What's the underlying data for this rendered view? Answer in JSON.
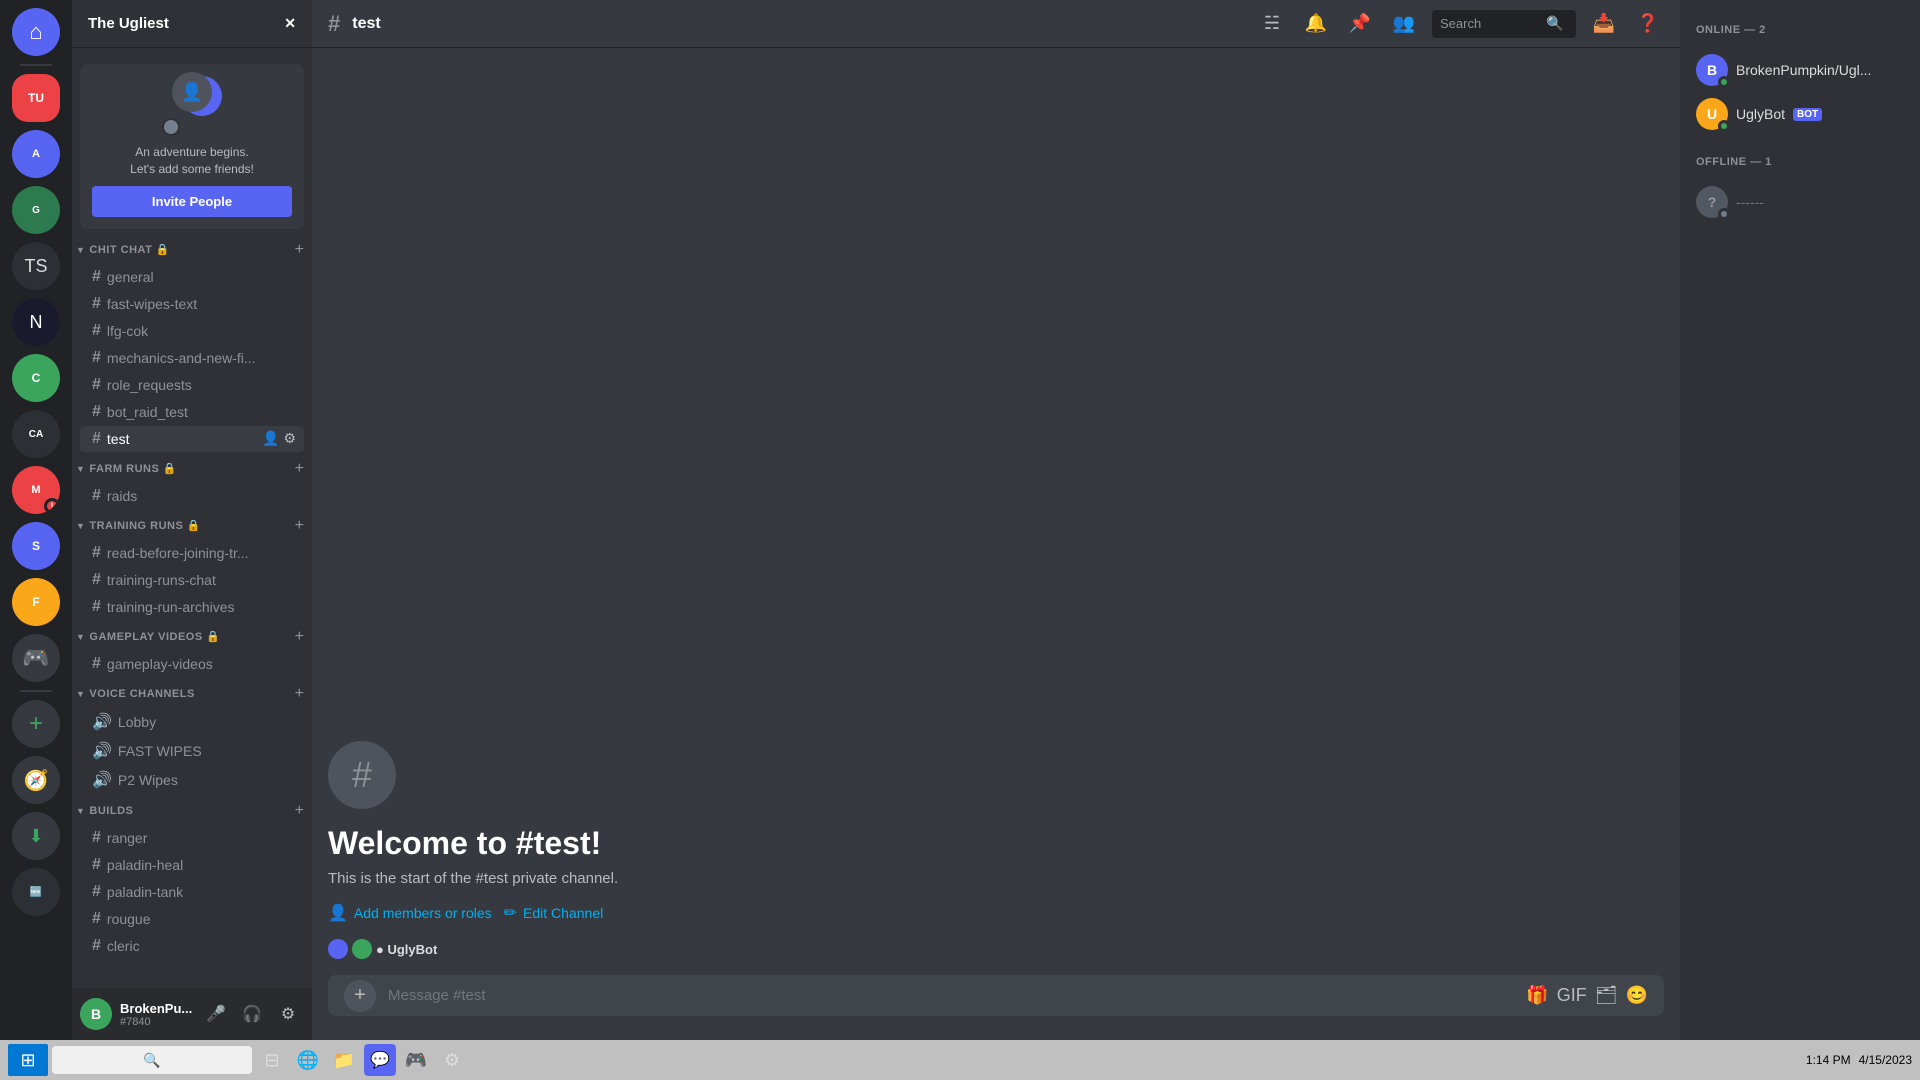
{
  "server": {
    "name": "The Ugliest",
    "channel_active": "test"
  },
  "header": {
    "channel_name": "test",
    "search_placeholder": "Search"
  },
  "invite_banner": {
    "line1": "An adventure begins.",
    "line2": "Let's add some friends!",
    "button_label": "Invite People"
  },
  "categories": [
    {
      "name": "CHIT CHAT",
      "locked": true,
      "channels": [
        "general",
        "fast-wipes-text",
        "lfg-cok",
        "mechanics-and-new-fi...",
        "role_requests",
        "bot_raid_test",
        "test"
      ]
    },
    {
      "name": "FARM RUNS",
      "locked": true,
      "channels": [
        "raids"
      ]
    },
    {
      "name": "TRAINING RUNS",
      "locked": true,
      "channels": [
        "read-before-joining-tr...",
        "training-runs-chat",
        "training-run-archives"
      ]
    },
    {
      "name": "GAMEPLAY VIDEOS",
      "locked": true,
      "channels": [
        "gameplay-videos"
      ]
    }
  ],
  "voice_section": {
    "name": "VOICE CHANNELS",
    "channels": [
      "Lobby",
      "FAST WIPES",
      "P2 Wipes"
    ]
  },
  "builds_section": {
    "name": "BUILDS",
    "channels": [
      "ranger",
      "paladin-heal",
      "paladin-tank",
      "rougue",
      "cleric"
    ]
  },
  "welcome": {
    "title": "Welcome to #test!",
    "description": "This is the start of the #test private channel.",
    "add_members_label": "Add members or roles",
    "edit_channel_label": "Edit Channel"
  },
  "message_input": {
    "placeholder": "Message #test"
  },
  "members": {
    "online_header": "ONLINE — 2",
    "offline_header": "OFFLINE — 1",
    "online_members": [
      {
        "name": "BrokenPumpkin/Ugl...",
        "badge": null,
        "status": "online"
      },
      {
        "name": "UglyBot",
        "badge": "BOT",
        "status": "online"
      }
    ],
    "offline_members": [
      {
        "name": "------",
        "status": "offline"
      }
    ]
  },
  "user_area": {
    "name": "BrokenPu...",
    "discriminator": "#7840"
  },
  "taskbar": {
    "time": "1:14 PM",
    "date": "4/15/2023"
  }
}
